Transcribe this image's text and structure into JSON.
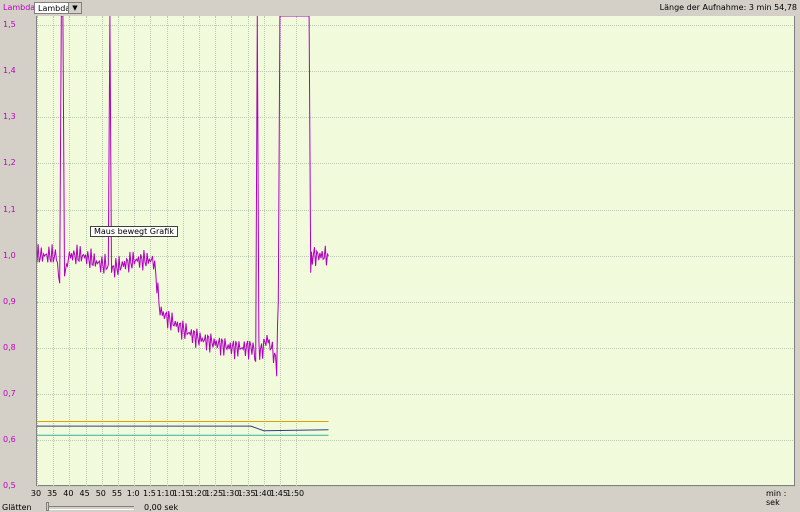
{
  "header": {
    "lambda_label": "Lambda",
    "selector_value": "Lambda",
    "recording_length": "Länge der Aufnahme: 3 min 54,78"
  },
  "y_axis": {
    "labels": [
      "1,5",
      "1,4",
      "1,3",
      "1,2",
      "1,1",
      "1,0",
      "0,9",
      "0,8",
      "0,7",
      "0,6",
      "0,5"
    ]
  },
  "x_axis": {
    "labels": [
      "30",
      "35",
      "40",
      "45",
      "50",
      "55",
      "1:0",
      "1:5",
      "1:10",
      "1:15",
      "1:20",
      "1:25",
      "1:30",
      "1:35",
      "1:40",
      "1:45",
      "1:50"
    ],
    "units": "min : sek"
  },
  "tooltip": "Maus bewegt Grafik",
  "smoothing": {
    "label": "Glätten",
    "value": "0,00 sek"
  },
  "colors": {
    "lambda": "#b000c0",
    "plot_bg": "#f2fadc",
    "line_orange": "#e0a000",
    "line_blue": "#304080",
    "line_cyan": "#30b0a0"
  },
  "chart_data": {
    "type": "line",
    "ylim": [
      0.5,
      1.52
    ],
    "xlim": [
      30,
      264
    ],
    "series": [
      {
        "x": [
          30,
          33,
          36,
          37,
          37.5,
          38,
          38.5,
          40,
          44,
          50,
          52,
          52.5,
          53,
          60,
          66,
          67,
          68,
          71,
          75,
          80,
          85,
          90,
          95,
          97,
          97.5,
          98,
          98.5,
          99,
          101,
          103,
          104,
          104.5,
          105,
          114,
          114.5,
          115,
          120
        ],
        "y": [
          1.0,
          1.0,
          1.0,
          0.94,
          1.52,
          1.52,
          0.96,
          1.0,
          1.0,
          0.98,
          0.98,
          1.52,
          0.97,
          0.99,
          0.99,
          0.94,
          0.88,
          0.86,
          0.84,
          0.82,
          0.81,
          0.8,
          0.8,
          0.8,
          0.77,
          1.52,
          0.8,
          0.79,
          0.82,
          0.79,
          0.76,
          0.9,
          1.52,
          1.52,
          0.97,
          1.0,
          1.0
        ]
      },
      {
        "x": [
          30,
          120
        ],
        "y": [
          0.64,
          0.64
        ]
      },
      {
        "x": [
          30,
          96,
          100,
          120
        ],
        "y": [
          0.63,
          0.63,
          0.62,
          0.622
        ]
      },
      {
        "x": [
          30,
          120
        ],
        "y": [
          0.61,
          0.61
        ]
      }
    ]
  }
}
